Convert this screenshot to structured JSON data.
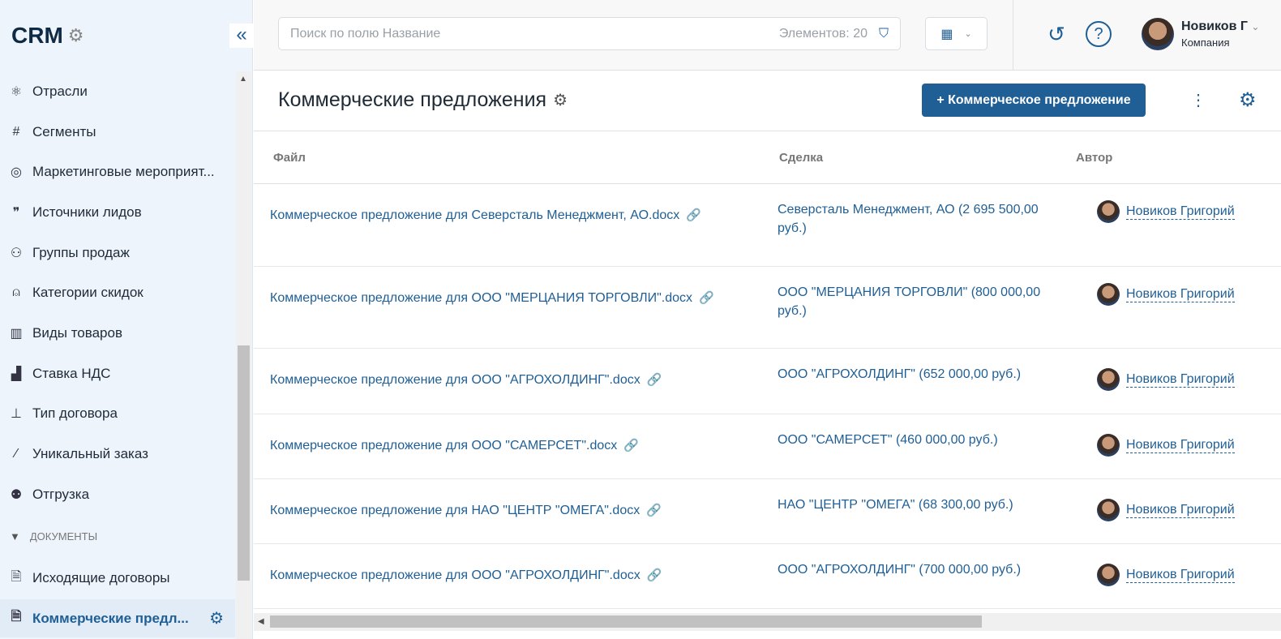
{
  "sidebar": {
    "logo": "CRM",
    "items": [
      {
        "label": "Отрасли",
        "icon": "atom-icon"
      },
      {
        "label": "Сегменты",
        "icon": "hash-icon"
      },
      {
        "label": "Маркетинговые мероприят...",
        "icon": "target-icon"
      },
      {
        "label": "Источники лидов",
        "icon": "quote-icon"
      },
      {
        "label": "Группы продаж",
        "icon": "users-icon"
      },
      {
        "label": "Категории скидок",
        "icon": "bell-icon"
      },
      {
        "label": "Виды товаров",
        "icon": "boxes-icon"
      },
      {
        "label": "Ставка НДС",
        "icon": "chart-icon"
      },
      {
        "label": "Тип договора",
        "icon": "hierarchy-icon"
      },
      {
        "label": "Уникальный заказ",
        "icon": "magic-wand-icon"
      },
      {
        "label": "Отгрузка",
        "icon": "people-icon"
      }
    ],
    "section": "ДОКУМЕНТЫ",
    "doc_items": [
      {
        "label": "Исходящие договоры"
      },
      {
        "label": "Коммерческие предл..."
      }
    ]
  },
  "topbar": {
    "search_placeholder": "Поиск по полю Название",
    "count": "Элементов: 20",
    "user_name": "Новиков Г",
    "user_company": "Компания"
  },
  "header": {
    "title": "Коммерческие предложения",
    "add_button": "+ Коммерческое предложение"
  },
  "colors": {
    "accent": "#1f5f95",
    "sidebar_bg": "#eef4fb"
  },
  "table": {
    "columns": [
      "Файл",
      "Сделка",
      "Автор"
    ],
    "rows": [
      {
        "file": "Коммерческое предложение для Северсталь Менеджмент, АО.docx",
        "deal": "Северсталь Менеджмент, АО (2 695 500,00 руб.)",
        "author": "Новиков Григорий"
      },
      {
        "file": "Коммерческое предложение для ООО \"МЕРЦАНИЯ ТОРГОВЛИ\".docx",
        "deal": "ООО \"МЕРЦАНИЯ ТОРГОВЛИ\" (800 000,00 руб.)",
        "author": "Новиков Григорий"
      },
      {
        "file": "Коммерческое предложение для ООО \"АГРОХОЛДИНГ\".docx",
        "deal": "ООО \"АГРОХОЛДИНГ\" (652 000,00 руб.)",
        "author": "Новиков Григорий"
      },
      {
        "file": "Коммерческое предложение для ООО \"САМЕРСЕТ\".docx",
        "deal": "ООО \"САМЕРСЕТ\" (460 000,00 руб.)",
        "author": "Новиков Григорий"
      },
      {
        "file": "Коммерческое предложение для НАО \"ЦЕНТР \"ОМЕГА\".docx",
        "deal": "НАО \"ЦЕНТР \"ОМЕГА\" (68 300,00 руб.)",
        "author": "Новиков Григорий"
      },
      {
        "file": "Коммерческое предложение для ООО \"АГРОХОЛДИНГ\".docx",
        "deal": "ООО \"АГРОХОЛДИНГ\" (700 000,00 руб.)",
        "author": "Новиков Григорий"
      }
    ]
  }
}
